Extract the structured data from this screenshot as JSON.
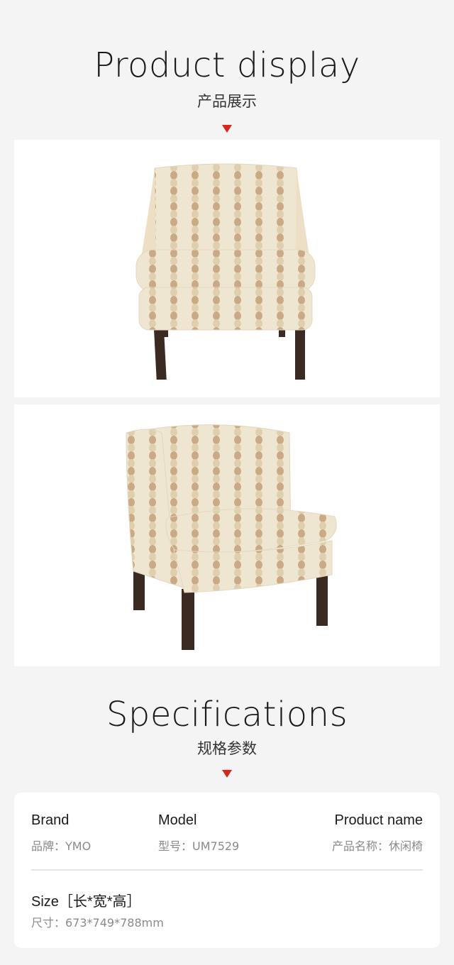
{
  "display": {
    "title_en": "Product display",
    "title_cn": "产品展示"
  },
  "specs": {
    "title_en": "Specifications",
    "title_cn": "规格参数",
    "brand_label": "Brand",
    "brand_value": "品牌：YMO",
    "model_label": "Model",
    "model_value": "型号：UM7529",
    "name_label": "Product name",
    "name_value": "产品名称：休闲椅",
    "size_label": "Size［长*宽*高］",
    "size_value": "尺寸：673*749*788mm"
  },
  "colors": {
    "accent_marker": "#d7261b",
    "page_bg": "#f4f4f4",
    "fabric": "#efe6d2",
    "pattern": "#c9a883",
    "legs": "#3a2a22"
  }
}
